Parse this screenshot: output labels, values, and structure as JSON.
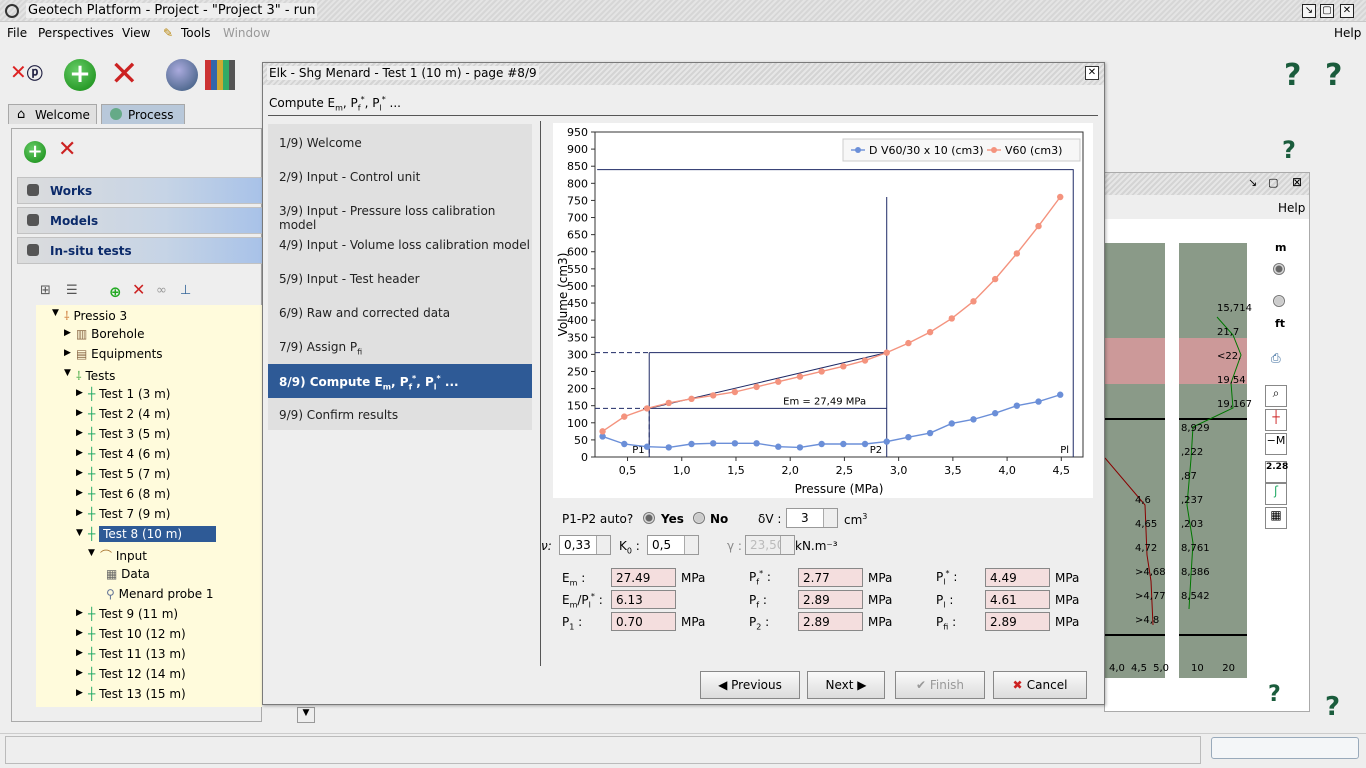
{
  "window": {
    "title": "Geotech Platform - Project - \"Project 3\" - run"
  },
  "menu": {
    "file": "File",
    "perspectives": "Perspectives",
    "view": "View",
    "tools": "Tools",
    "window": "Window",
    "help": "Help"
  },
  "tabs": {
    "welcome": "Welcome",
    "process": "Process"
  },
  "sections": {
    "works": "Works",
    "models": "Models",
    "insitu": "In-situ tests"
  },
  "tree": {
    "root": "Pressio 3",
    "borehole": "Borehole",
    "equipments": "Equipments",
    "tests": "Tests",
    "items": [
      "Test 1 (3 m)",
      "Test 2 (4 m)",
      "Test 3 (5 m)",
      "Test 4 (6 m)",
      "Test 5 (7 m)",
      "Test 6 (8 m)",
      "Test 7 (9 m)",
      "Test 8 (10 m)"
    ],
    "input": "Input",
    "data": "Data",
    "probe": "Menard probe 1",
    "items2": [
      "Test 9 (11 m)",
      "Test 10 (12 m)",
      "Test 11 (13 m)",
      "Test 12 (14 m)",
      "Test 13 (15 m)"
    ]
  },
  "rightpanel": {
    "help": "Help",
    "unit_m": "m",
    "unit_ft": "ft",
    "scale": "2.28",
    "left_labels": [
      "4,6",
      "4,65",
      "4,72",
      ">4,68",
      ">4,77",
      ">4,8"
    ],
    "right_labels": [
      "15,714",
      "21,7",
      "<22,",
      "19,54",
      "19,167",
      "8,929",
      ",222",
      ",87",
      ",237",
      ",203",
      "8,761",
      "8,386",
      "8,542"
    ],
    "axis_left": [
      "4,0",
      "4,5",
      "5,0"
    ],
    "axis_right": [
      "10",
      "20"
    ]
  },
  "dialog": {
    "title": "Elk - Shg Menard - Test 1 (10 m) - page #8/9",
    "subtitle_a": "Compute E",
    "subtitle_b": "m",
    "subtitle_c": ", P",
    "subtitle_d": "f",
    "subtitle_e": "*",
    "subtitle_f": ", P",
    "subtitle_g": "l",
    "subtitle_h": "*",
    "subtitle_i": " ...",
    "steps": [
      "1/9) Welcome",
      "2/9) Input - Control unit",
      "3/9) Input - Pressure loss calibration model",
      "4/9) Input - Volume loss calibration model",
      "5/9) Input - Test header",
      "6/9) Raw and corrected data",
      "7/9) Assign P",
      "8/9) Compute E",
      "9/9) Confirm results"
    ],
    "step7_sub": "fi",
    "step8_tail": "m, Pf*, Pl* ...",
    "p1p2_label": "P1-P2 auto?",
    "yes": "Yes",
    "no": "No",
    "dv_label": "δV :",
    "dv_value": "3",
    "dv_unit": "cm",
    "dv_unit_sup": "3",
    "nu_label": "ν:",
    "nu_value": "0,33",
    "k0_label": "K",
    "k0_sub": "0",
    "k0_colon": ":",
    "k0_value": "0,5",
    "gamma_label": "γ :",
    "gamma_value": "23,50",
    "gamma_unit": "kN.m⁻³",
    "em_label": "E",
    "em_sub": "m",
    "em_colon": ":",
    "em_value": "27.49",
    "em_unit": "MPa",
    "pfs_label": "P",
    "pfs_sub": "f",
    "pfs_sup": "*",
    "pfs_colon": ":",
    "pfs_value": "2.77",
    "pfs_unit": "MPa",
    "pls_label": "P",
    "pls_sub": "l",
    "pls_sup": "*",
    "pls_colon": ":",
    "pls_value": "4.49",
    "pls_unit": "MPa",
    "empl_label": "E",
    "empl_sub": "m",
    "empl_mid": "/P",
    "empl_sub2": "l",
    "empl_sup": "*",
    "empl_colon": ":",
    "empl_value": "6.13",
    "pf_label": "P",
    "pf_sub": "f",
    "pf_colon": ":",
    "pf_value": "2.89",
    "pf_unit": "MPa",
    "pl_label": "P",
    "pl_sub": "l",
    "pl_colon": ":",
    "pl_value": "4.61",
    "pl_unit": "MPa",
    "p1_label": "P",
    "p1_sub": "1",
    "p1_colon": ":",
    "p1_value": "0.70",
    "p1_unit": "MPa",
    "p2_label": "P",
    "p2_sub": "2",
    "p2_colon": ":",
    "p2_value": "2.89",
    "p2_unit": "MPa",
    "pfi_label": "P",
    "pfi_sub": "fi",
    "pfi_colon": ":",
    "pfi_value": "2.89",
    "pfi_unit": "MPa",
    "buttons": {
      "previous": "Previous",
      "next": "Next",
      "finish": "Finish",
      "cancel": "Cancel"
    }
  },
  "chart_data": {
    "type": "line",
    "xlabel": "Pressure (MPa)",
    "ylabel": "Volume (cm3)",
    "xlim": [
      0.2,
      4.7
    ],
    "ylim": [
      0,
      950
    ],
    "xticks": [
      "0,5",
      "1,0",
      "1,5",
      "2,0",
      "2,5",
      "3,0",
      "3,5",
      "4,0",
      "4,5"
    ],
    "xtick_values": [
      0.5,
      1.0,
      1.5,
      2.0,
      2.5,
      3.0,
      3.5,
      4.0,
      4.5
    ],
    "yticks": [
      0,
      50,
      100,
      150,
      200,
      250,
      300,
      350,
      400,
      450,
      500,
      550,
      600,
      650,
      700,
      750,
      800,
      850,
      900,
      950
    ],
    "legend_position": "top-right",
    "series": [
      {
        "name": "D V60/30 x 10 (cm3)",
        "color": "#6b8fd8",
        "x": [
          0.27,
          0.47,
          0.68,
          0.88,
          1.09,
          1.29,
          1.49,
          1.69,
          1.89,
          2.09,
          2.29,
          2.49,
          2.69,
          2.89,
          3.09,
          3.29,
          3.49,
          3.69,
          3.89,
          4.09,
          4.29,
          4.49
        ],
        "y": [
          60,
          38,
          30,
          28,
          38,
          40,
          40,
          40,
          30,
          28,
          38,
          38,
          38,
          45,
          58,
          70,
          98,
          110,
          128,
          150,
          162,
          182
        ]
      },
      {
        "name": "V60 (cm3)",
        "color": "#f4937e",
        "x": [
          0.27,
          0.47,
          0.68,
          0.88,
          1.09,
          1.29,
          1.49,
          1.69,
          1.89,
          2.09,
          2.29,
          2.49,
          2.69,
          2.89,
          3.09,
          3.29,
          3.49,
          3.69,
          3.89,
          4.09,
          4.29,
          4.49
        ],
        "y": [
          75,
          118,
          142,
          158,
          170,
          180,
          190,
          205,
          220,
          235,
          250,
          265,
          282,
          305,
          333,
          365,
          405,
          455,
          520,
          595,
          675,
          760
        ]
      }
    ],
    "annotations": {
      "em_text": "Em = 27,49 MPa",
      "p1": "P1",
      "p2": "P2",
      "pl": "Pl",
      "p1_x": 0.7,
      "p1_y": 142,
      "p2_x": 2.89,
      "p2_y": 305,
      "pl_x": 4.61
    }
  }
}
